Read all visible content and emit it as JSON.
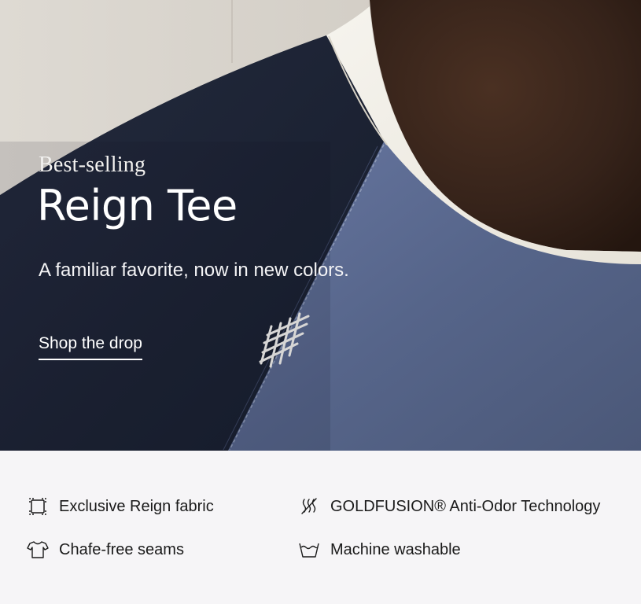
{
  "hero": {
    "eyebrow": "Best-selling",
    "title": "Reign Tee",
    "subtitle": "A familiar favorite, now in new colors.",
    "cta_label": "Shop the drop"
  },
  "features": [
    {
      "label": "Exclusive Reign fabric",
      "icon": "fabric-swatch-icon"
    },
    {
      "label": "GOLDFUSION® Anti-Odor Technology",
      "icon": "anti-odor-icon"
    },
    {
      "label": "Chafe-free seams",
      "icon": "t-shirt-icon"
    },
    {
      "label": "Machine washable",
      "icon": "wash-basin-icon"
    }
  ],
  "colors": {
    "navy": "#1d2436",
    "slate_blue": "#5a6a8c",
    "collar": "#f1efe7",
    "skin": "#3a2519",
    "wall": "#d9d4cd",
    "feature_bg": "#f6f5f7",
    "text_dark": "#1a1a1a"
  }
}
